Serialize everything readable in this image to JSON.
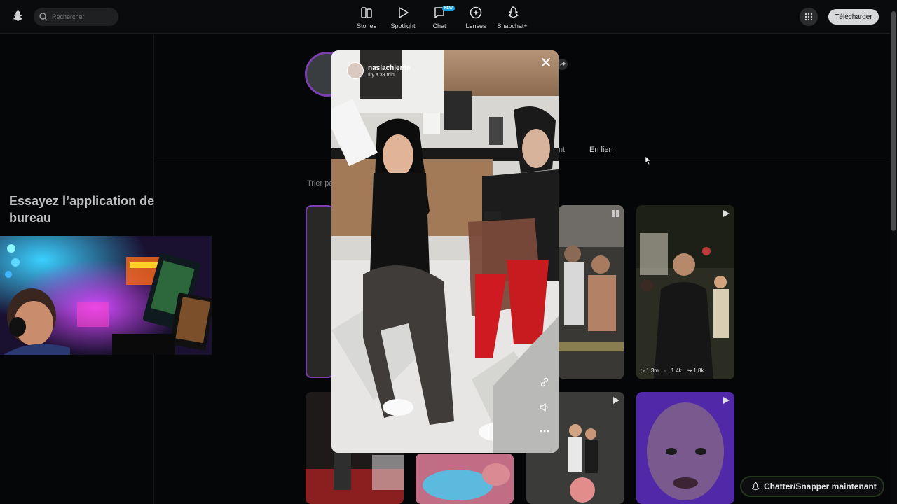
{
  "topbar": {
    "search_placeholder": "Rechercher",
    "nav": [
      {
        "label": "Stories",
        "icon": "stories-icon"
      },
      {
        "label": "Spotlight",
        "icon": "spotlight-play-icon"
      },
      {
        "label": "Chat",
        "icon": "chat-icon",
        "badge": "NEW"
      },
      {
        "label": "Lenses",
        "icon": "lenses-icon"
      },
      {
        "label": "Snapchat+",
        "icon": "snapchat-plus-icon"
      }
    ],
    "download_label": "Télécharger"
  },
  "left_panel": {
    "promo_title": "Essayez l’application de bureau"
  },
  "profile": {
    "tab_fragment": "nt",
    "tab_linked": "En lien",
    "sort_label": "Trier pa"
  },
  "cards": [
    {
      "views": "1.3m",
      "comments": "1.4k",
      "shares": "1.8k"
    }
  ],
  "viewer": {
    "username": "naslachiente",
    "time_ago": "Il y a 39 min"
  },
  "chat_button": {
    "label": "Chatter/Snapper maintenant"
  },
  "colors": {
    "accent_purple": "#7b3fb0",
    "badge_blue": "#16a4e8",
    "background": "#050607"
  }
}
